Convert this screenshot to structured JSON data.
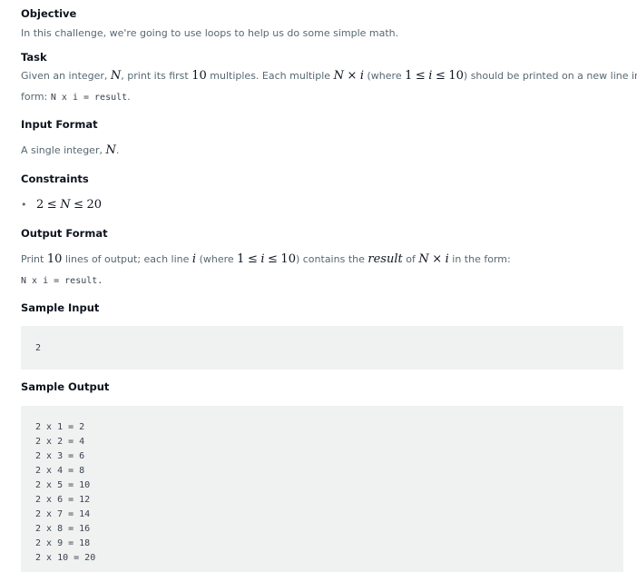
{
  "objective": {
    "heading": "Objective",
    "text": "In this challenge, we're going to use loops to help us do some simple math."
  },
  "task": {
    "heading": "Task",
    "line1_a": "Given an integer,",
    "var_N": "N",
    "line1_b": ", print its first",
    "num_10": "10",
    "line1_c": "multiples. Each multiple",
    "times": "×",
    "var_i": "i",
    "line1_d": "(where",
    "num_1": "1",
    "leq": "≤",
    "line1_e": ") should be printed on a new line in the",
    "line2_a": "form:",
    "code": "N x i = result",
    "line2_b": "."
  },
  "input_format": {
    "heading": "Input Format",
    "text_a": "A single integer,",
    "var_N": "N",
    "text_b": "."
  },
  "constraints": {
    "heading": "Constraints",
    "bullet": "•",
    "low": "2",
    "leq": "≤",
    "var_N": "N",
    "high": "20"
  },
  "output_format": {
    "heading": "Output Format",
    "text_a": "Print",
    "num_10": "10",
    "text_b": "lines of output; each line",
    "var_i": "i",
    "text_c": "(where",
    "num_1": "1",
    "leq": "≤",
    "text_d": ") contains the",
    "var_result": "result",
    "text_e": "of",
    "var_N": "N",
    "times": "×",
    "text_f": "in the form:",
    "code_line": "N x i = result."
  },
  "sample_input": {
    "heading": "Sample Input",
    "content": "2"
  },
  "sample_output": {
    "heading": "Sample Output",
    "lines": [
      "2 x 1 = 2",
      "2 x 2 = 4",
      "2 x 3 = 6",
      "2 x 4 = 8",
      "2 x 5 = 10",
      "2 x 6 = 12",
      "2 x 7 = 14",
      "2 x 8 = 16",
      "2 x 9 = 18",
      "2 x 10 = 20"
    ]
  }
}
